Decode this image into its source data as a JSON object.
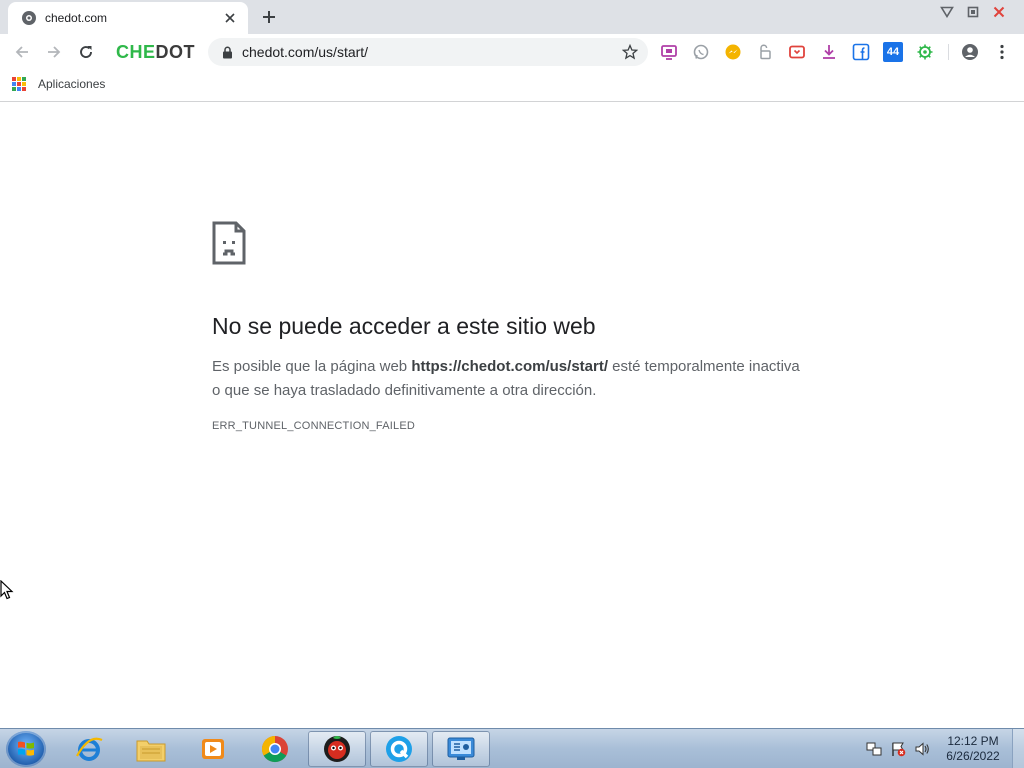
{
  "browser": {
    "tab_title": "chedot.com",
    "brand_left": "CHE",
    "brand_right": "DOT",
    "url": "chedot.com/us/start/",
    "bookmarks": {
      "apps_label": "Aplicaciones"
    },
    "extension_badge": "44",
    "colors": {
      "brand_green": "#2fb84a",
      "tab_strip": "#dee1e6",
      "close_red": "#e0433c"
    }
  },
  "error_page": {
    "title": "No se puede acceder a este sitio web",
    "body_prefix": "Es posible que la página web ",
    "body_url": "https://chedot.com/us/start/",
    "body_suffix": " esté temporalmente inactiva o que se haya trasladado definitivamente a otra dirección.",
    "error_code": "ERR_TUNNEL_CONNECTION_FAILED"
  },
  "taskbar": {
    "items": [
      "internet-explorer-icon",
      "file-explorer-icon",
      "media-player-icon",
      "chrome-icon",
      "chedot-icon",
      "q-app-icon",
      "control-panel-icon"
    ],
    "clock_time": "12:12 PM",
    "clock_date": "6/26/2022"
  }
}
